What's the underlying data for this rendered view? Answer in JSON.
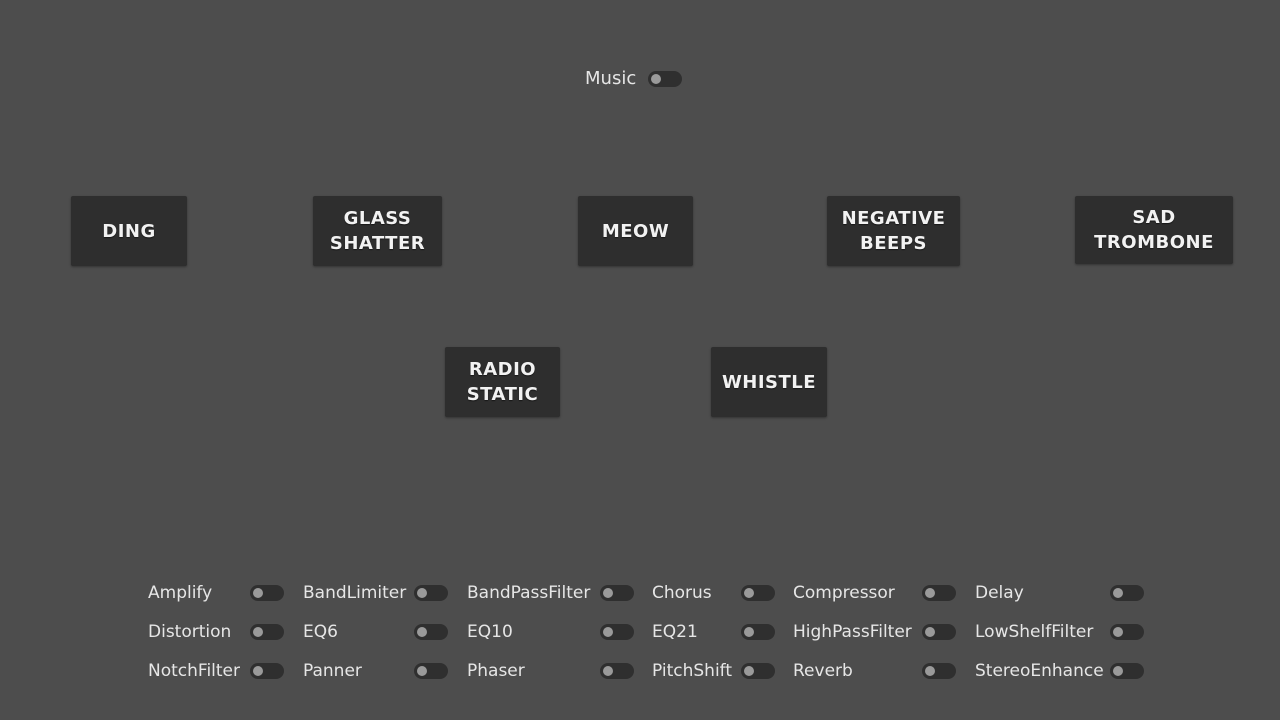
{
  "music": {
    "label": "Music",
    "enabled": false
  },
  "sounds": [
    {
      "id": "ding",
      "label": "DING"
    },
    {
      "id": "glass",
      "label": "GLASS\nSHATTER"
    },
    {
      "id": "meow",
      "label": "MEOW"
    },
    {
      "id": "negative",
      "label": "NEGATIVE\nBEEPS"
    },
    {
      "id": "trombone",
      "label": "SAD\nTROMBONE"
    },
    {
      "id": "radio",
      "label": "RADIO\nSTATIC"
    },
    {
      "id": "whistle",
      "label": "WHISTLE"
    }
  ],
  "effects": [
    {
      "label": "Amplify",
      "enabled": false
    },
    {
      "label": "BandLimiter",
      "enabled": false
    },
    {
      "label": "BandPassFilter",
      "enabled": false
    },
    {
      "label": "Chorus",
      "enabled": false
    },
    {
      "label": "Compressor",
      "enabled": false
    },
    {
      "label": "Delay",
      "enabled": false
    },
    {
      "label": "Distortion",
      "enabled": false
    },
    {
      "label": "EQ6",
      "enabled": false
    },
    {
      "label": "EQ10",
      "enabled": false
    },
    {
      "label": "EQ21",
      "enabled": false
    },
    {
      "label": "HighPassFilter",
      "enabled": false
    },
    {
      "label": "LowShelfFilter",
      "enabled": false
    },
    {
      "label": "NotchFilter",
      "enabled": false
    },
    {
      "label": "Panner",
      "enabled": false
    },
    {
      "label": "Phaser",
      "enabled": false
    },
    {
      "label": "PitchShift",
      "enabled": false
    },
    {
      "label": "Reverb",
      "enabled": false
    },
    {
      "label": "StereoEnhance",
      "enabled": false
    }
  ],
  "colors": {
    "background": "#4d4d4d",
    "button": "#2e2e2e",
    "toggle_track": "#2f2f2f",
    "toggle_knob": "#9a9a9a",
    "text": "#e6e6e6"
  }
}
